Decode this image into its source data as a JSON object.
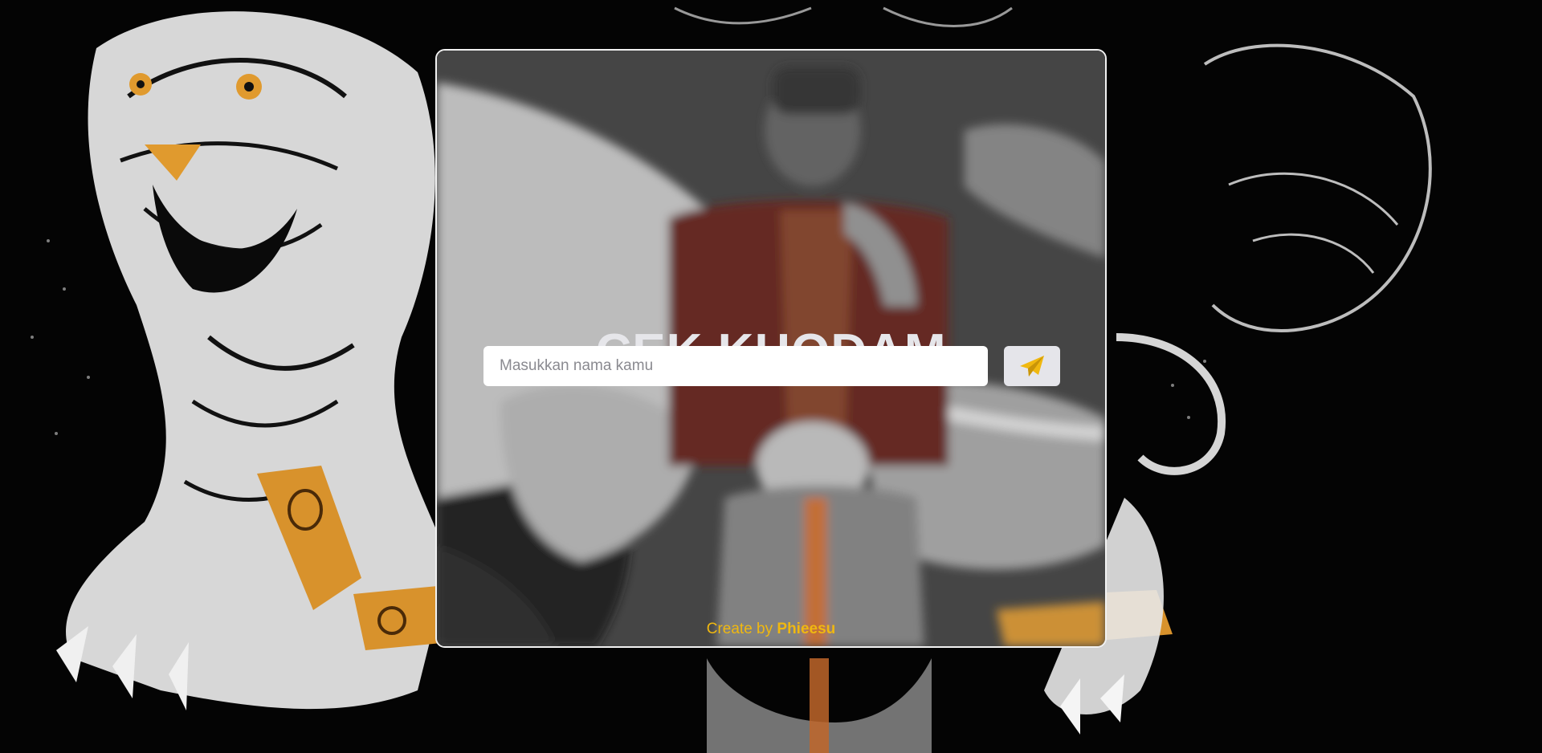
{
  "app": {
    "title": "CEK KHODAM"
  },
  "form": {
    "name_placeholder": "Masukkan nama kamu",
    "name_value": "",
    "submit_icon": "paper-plane-icon"
  },
  "footer": {
    "prefix": "Create by",
    "author": "Phieesu"
  },
  "colors": {
    "accent": "#f0b810",
    "title": "#e6e6ea",
    "card_border": "#f2f2f2",
    "button_bg": "#e5e5ea",
    "background": "#000000"
  }
}
